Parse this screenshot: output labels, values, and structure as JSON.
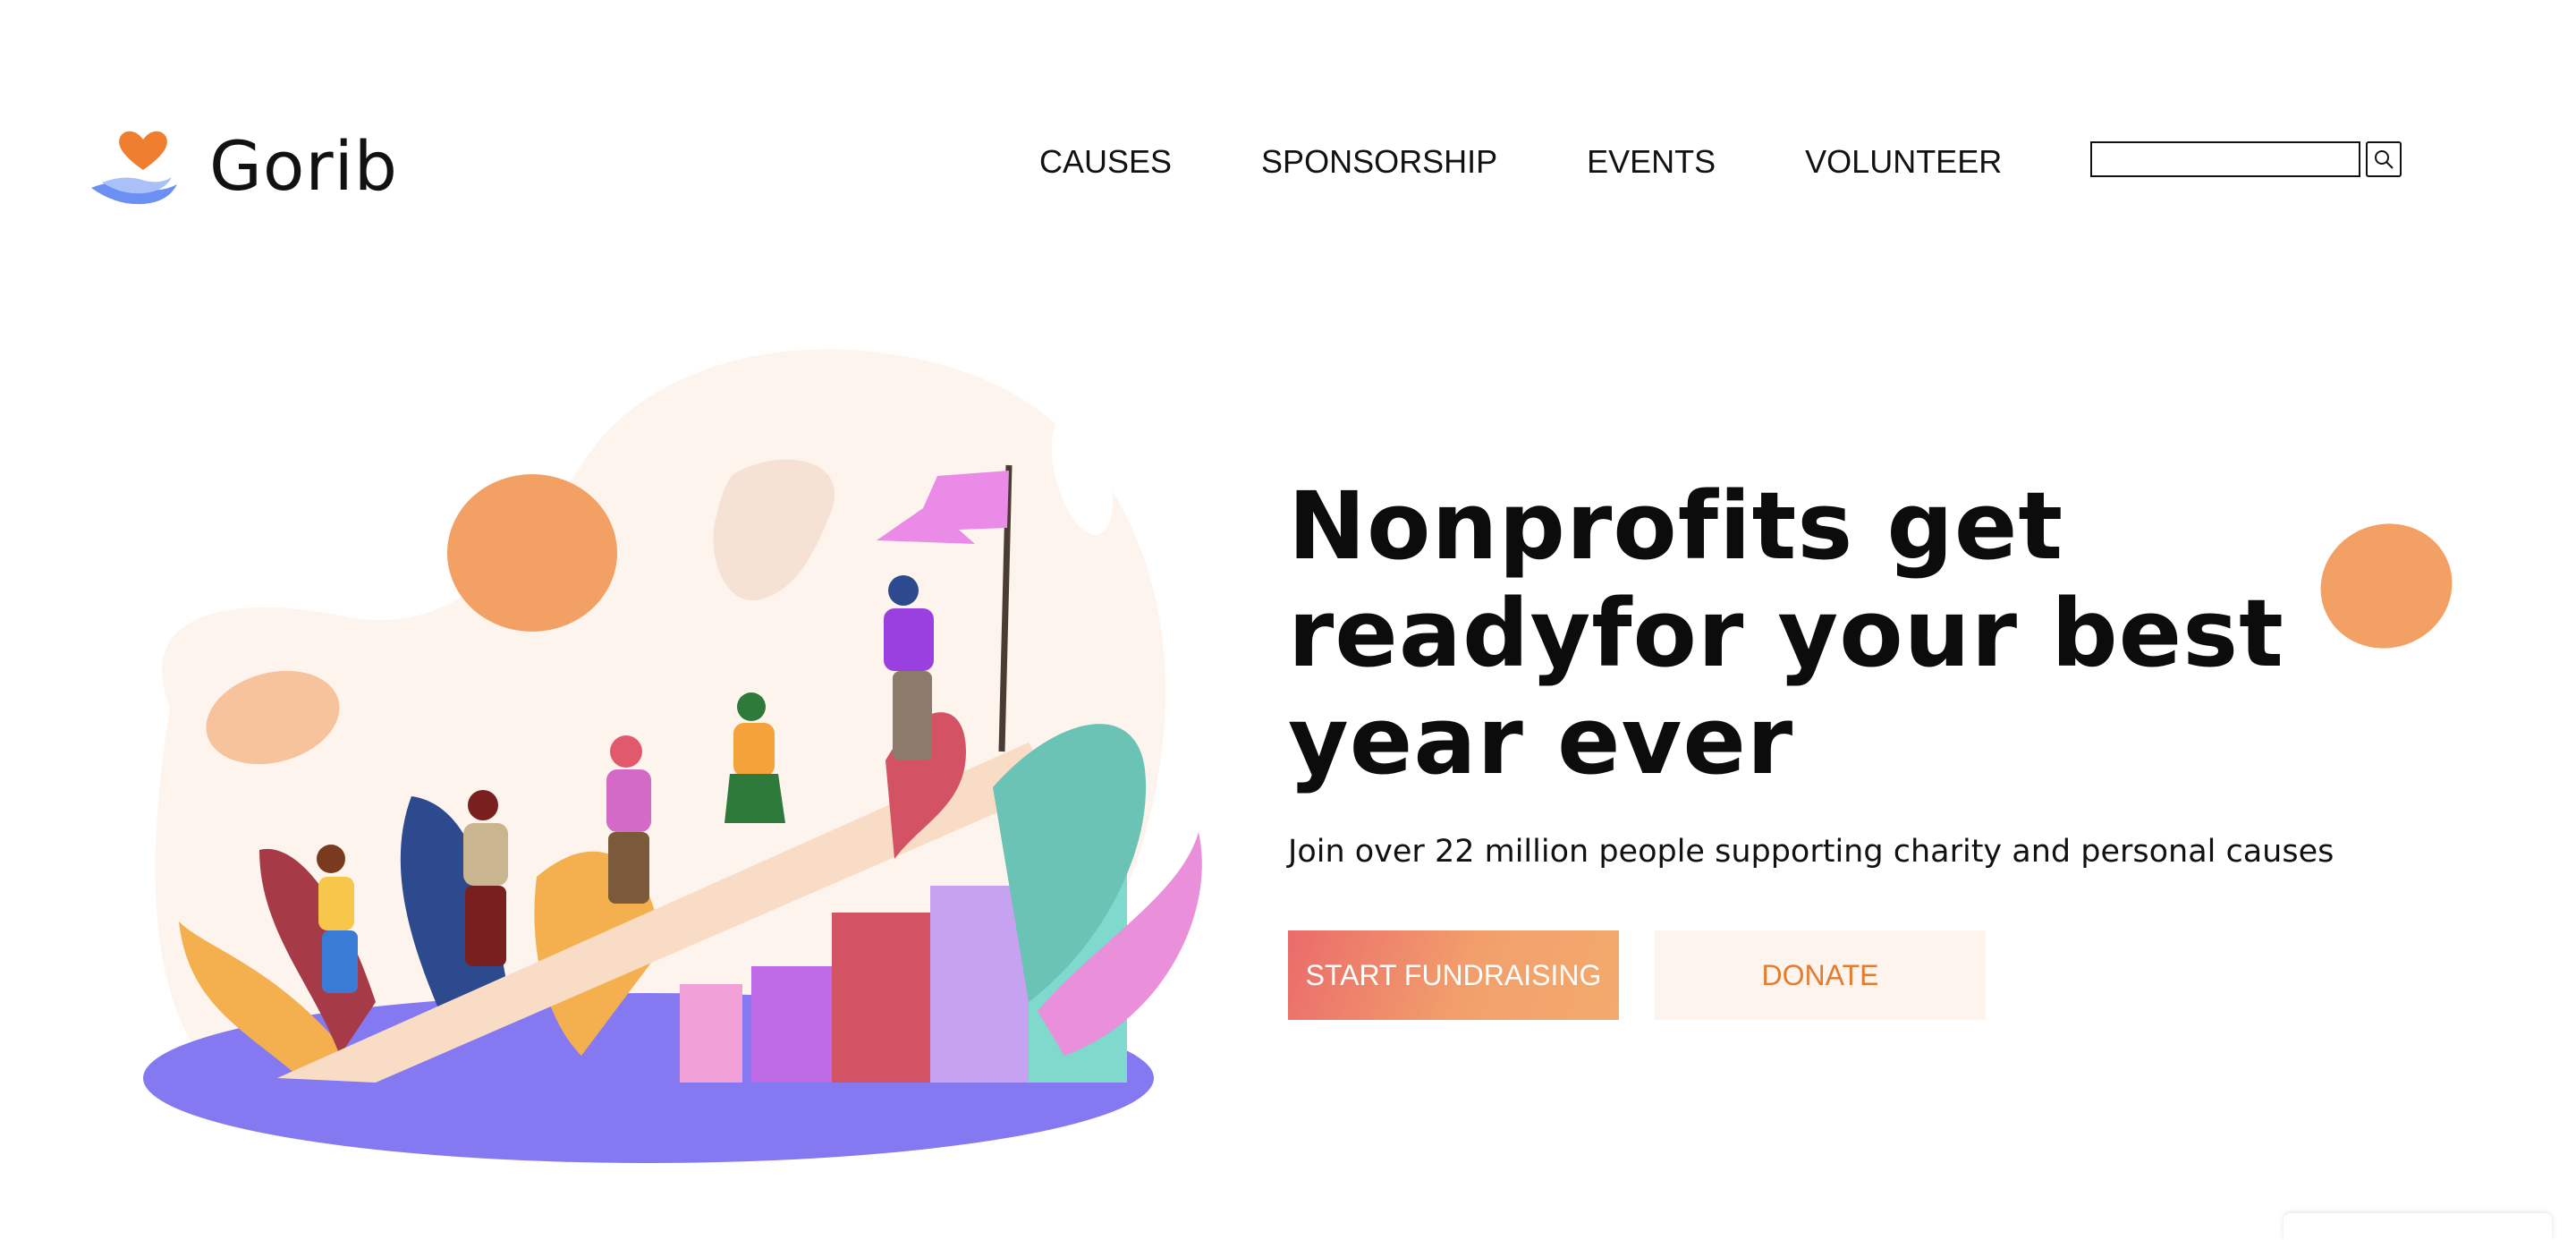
{
  "brand": {
    "name": "Gorib"
  },
  "nav": {
    "items": [
      {
        "label": "CAUSES"
      },
      {
        "label": "SPONSORSHIP"
      },
      {
        "label": "EVENTS"
      },
      {
        "label": "VOLUNTEER"
      }
    ]
  },
  "search": {
    "value": "",
    "button_icon": "search-icon"
  },
  "hero": {
    "title": "Nonprofits get readyfor your best year ever",
    "subtitle": "Join over 22 million people supporting charity and personal causes",
    "primary_cta": "START FUNDRAISING",
    "secondary_cta": "DONATE"
  },
  "colors": {
    "accent_orange": "#f3a065",
    "button_gradient_start": "#ea6b6b",
    "button_gradient_end": "#f3aa6d",
    "donate_bg": "#fdf4ee",
    "donate_text": "#e57b2e",
    "ground": "#8479f0"
  }
}
